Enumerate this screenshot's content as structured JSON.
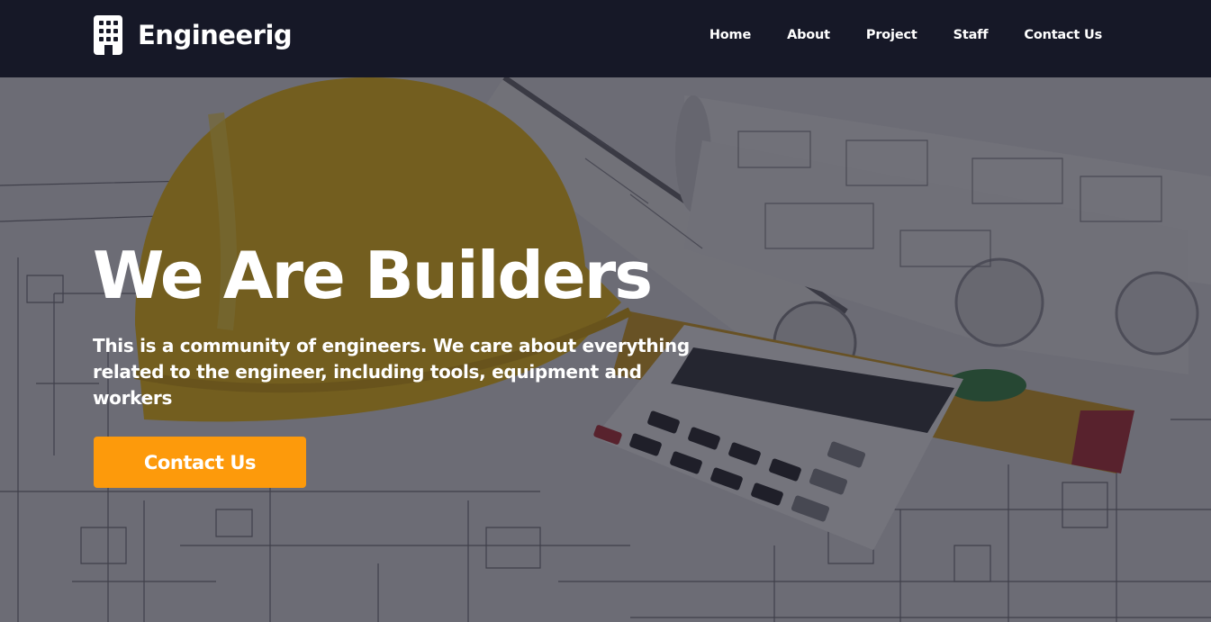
{
  "brand": {
    "name": "Engineerig",
    "icon": "building-icon"
  },
  "nav": {
    "items": [
      {
        "label": "Home"
      },
      {
        "label": "About"
      },
      {
        "label": "Project"
      },
      {
        "label": "Staff"
      },
      {
        "label": "Contact Us"
      }
    ]
  },
  "hero": {
    "title": "We Are Builders",
    "subtitle": "This is a community of engineers. We care about everything related to the engineer, including tools, equipment and workers",
    "button_label": "Contact Us",
    "background": "blueprints-hardhat-calculator-photo"
  },
  "colors": {
    "navbar": "#161827",
    "accent": "#fd9a0b",
    "text": "#ffffff",
    "hardhat": "#f2c21b"
  }
}
